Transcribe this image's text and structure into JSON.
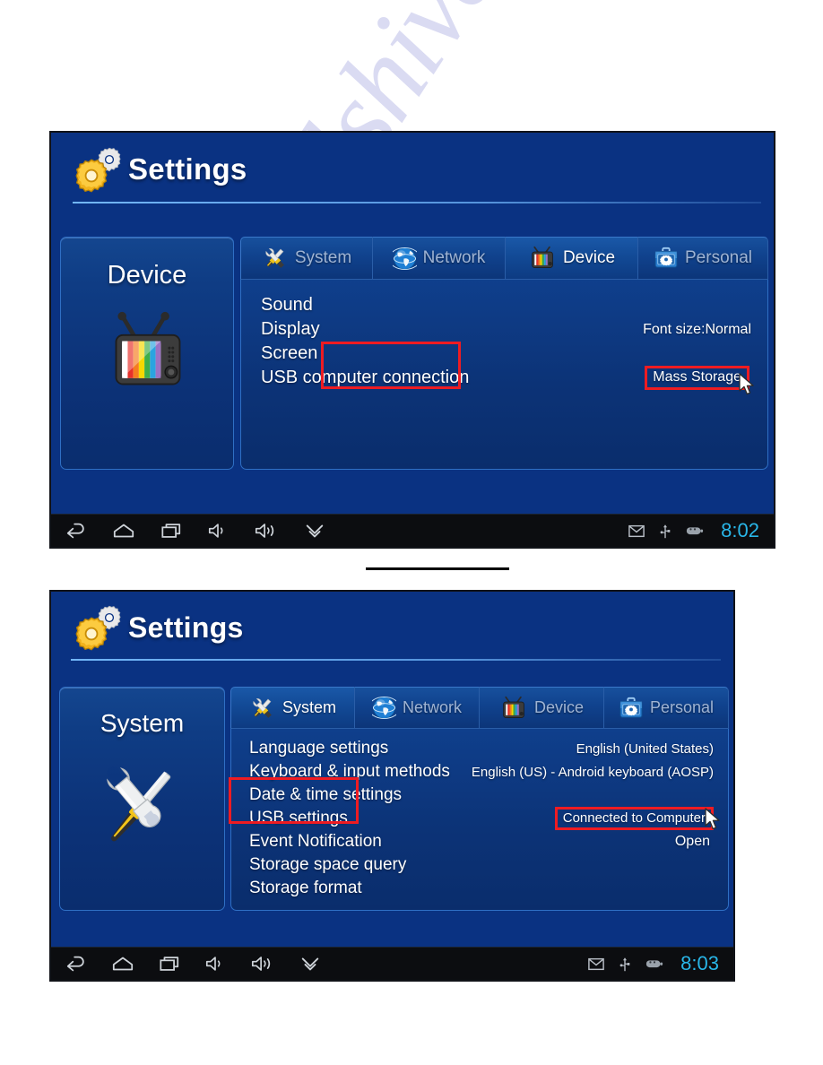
{
  "watermark": {
    "text": "manualshive.com"
  },
  "screenshots": [
    {
      "id": "device-settings",
      "header": {
        "title": "Settings",
        "gear_large_icon": "gear-icon",
        "gear_small_icon": "gear-icon"
      },
      "left_panel": {
        "title": "Device",
        "icon": "tv-icon"
      },
      "tabs": [
        {
          "label": "System",
          "icon": "tools-icon",
          "active": false,
          "highlighted": false
        },
        {
          "label": "Network",
          "icon": "globe-icon",
          "active": false,
          "highlighted": false
        },
        {
          "label": "Device",
          "icon": "tv-icon",
          "active": true,
          "highlighted": true
        },
        {
          "label": "Personal",
          "icon": "briefcase-icon",
          "active": false,
          "highlighted": false
        }
      ],
      "rows": [
        {
          "label": "Sound",
          "value": ""
        },
        {
          "label": "Display",
          "value": "Font size:Normal"
        },
        {
          "label": "Screen",
          "value": ""
        },
        {
          "label": "USB computer connection",
          "value": "Mass Storage",
          "value_highlighted": true
        }
      ],
      "navbar": {
        "buttons": [
          {
            "icon": "back-icon"
          },
          {
            "icon": "home-icon"
          },
          {
            "icon": "recents-icon"
          },
          {
            "icon": "volume-down-icon"
          },
          {
            "icon": "volume-up-icon"
          },
          {
            "icon": "chevron-double-down-icon"
          }
        ],
        "status_icons": [
          {
            "icon": "mail-icon"
          },
          {
            "icon": "usb-icon"
          },
          {
            "icon": "battery-icon"
          }
        ],
        "clock": "8:02"
      }
    },
    {
      "id": "system-settings",
      "header": {
        "title": "Settings",
        "gear_large_icon": "gear-icon",
        "gear_small_icon": "gear-icon"
      },
      "left_panel": {
        "title": "System",
        "icon": "tools-icon"
      },
      "tabs": [
        {
          "label": "System",
          "icon": "tools-icon",
          "active": true,
          "highlighted": true
        },
        {
          "label": "Network",
          "icon": "globe-icon",
          "active": false,
          "highlighted": false
        },
        {
          "label": "Device",
          "icon": "tv-icon",
          "active": false,
          "highlighted": false
        },
        {
          "label": "Personal",
          "icon": "briefcase-icon",
          "active": false,
          "highlighted": false
        }
      ],
      "rows": [
        {
          "label": "Language settings",
          "value": "English (United States)"
        },
        {
          "label": "Keyboard & input methods",
          "value": "English (US) - Android keyboard (AOSP)"
        },
        {
          "label": "Date & time settings",
          "value": ""
        },
        {
          "label": "USB settings",
          "value": "Connected to Computer",
          "value_highlighted": true
        },
        {
          "label": "Event Notification",
          "value": "Open"
        },
        {
          "label": "Storage space query",
          "value": ""
        },
        {
          "label": "Storage format",
          "value": ""
        }
      ],
      "navbar": {
        "buttons": [
          {
            "icon": "back-icon"
          },
          {
            "icon": "home-icon"
          },
          {
            "icon": "recents-icon"
          },
          {
            "icon": "volume-down-icon"
          },
          {
            "icon": "volume-up-icon"
          },
          {
            "icon": "chevron-double-down-icon"
          }
        ],
        "status_icons": [
          {
            "icon": "mail-icon"
          },
          {
            "icon": "usb-icon"
          },
          {
            "icon": "battery-icon"
          }
        ],
        "clock": "8:03"
      }
    }
  ],
  "colors": {
    "screen_blue": "#0a3282",
    "highlight_red": "#ee1c22",
    "clock_cyan": "#29b6e8",
    "tab_inactive_text": "#9fb4d4",
    "tab_active_text": "#ffffff"
  }
}
